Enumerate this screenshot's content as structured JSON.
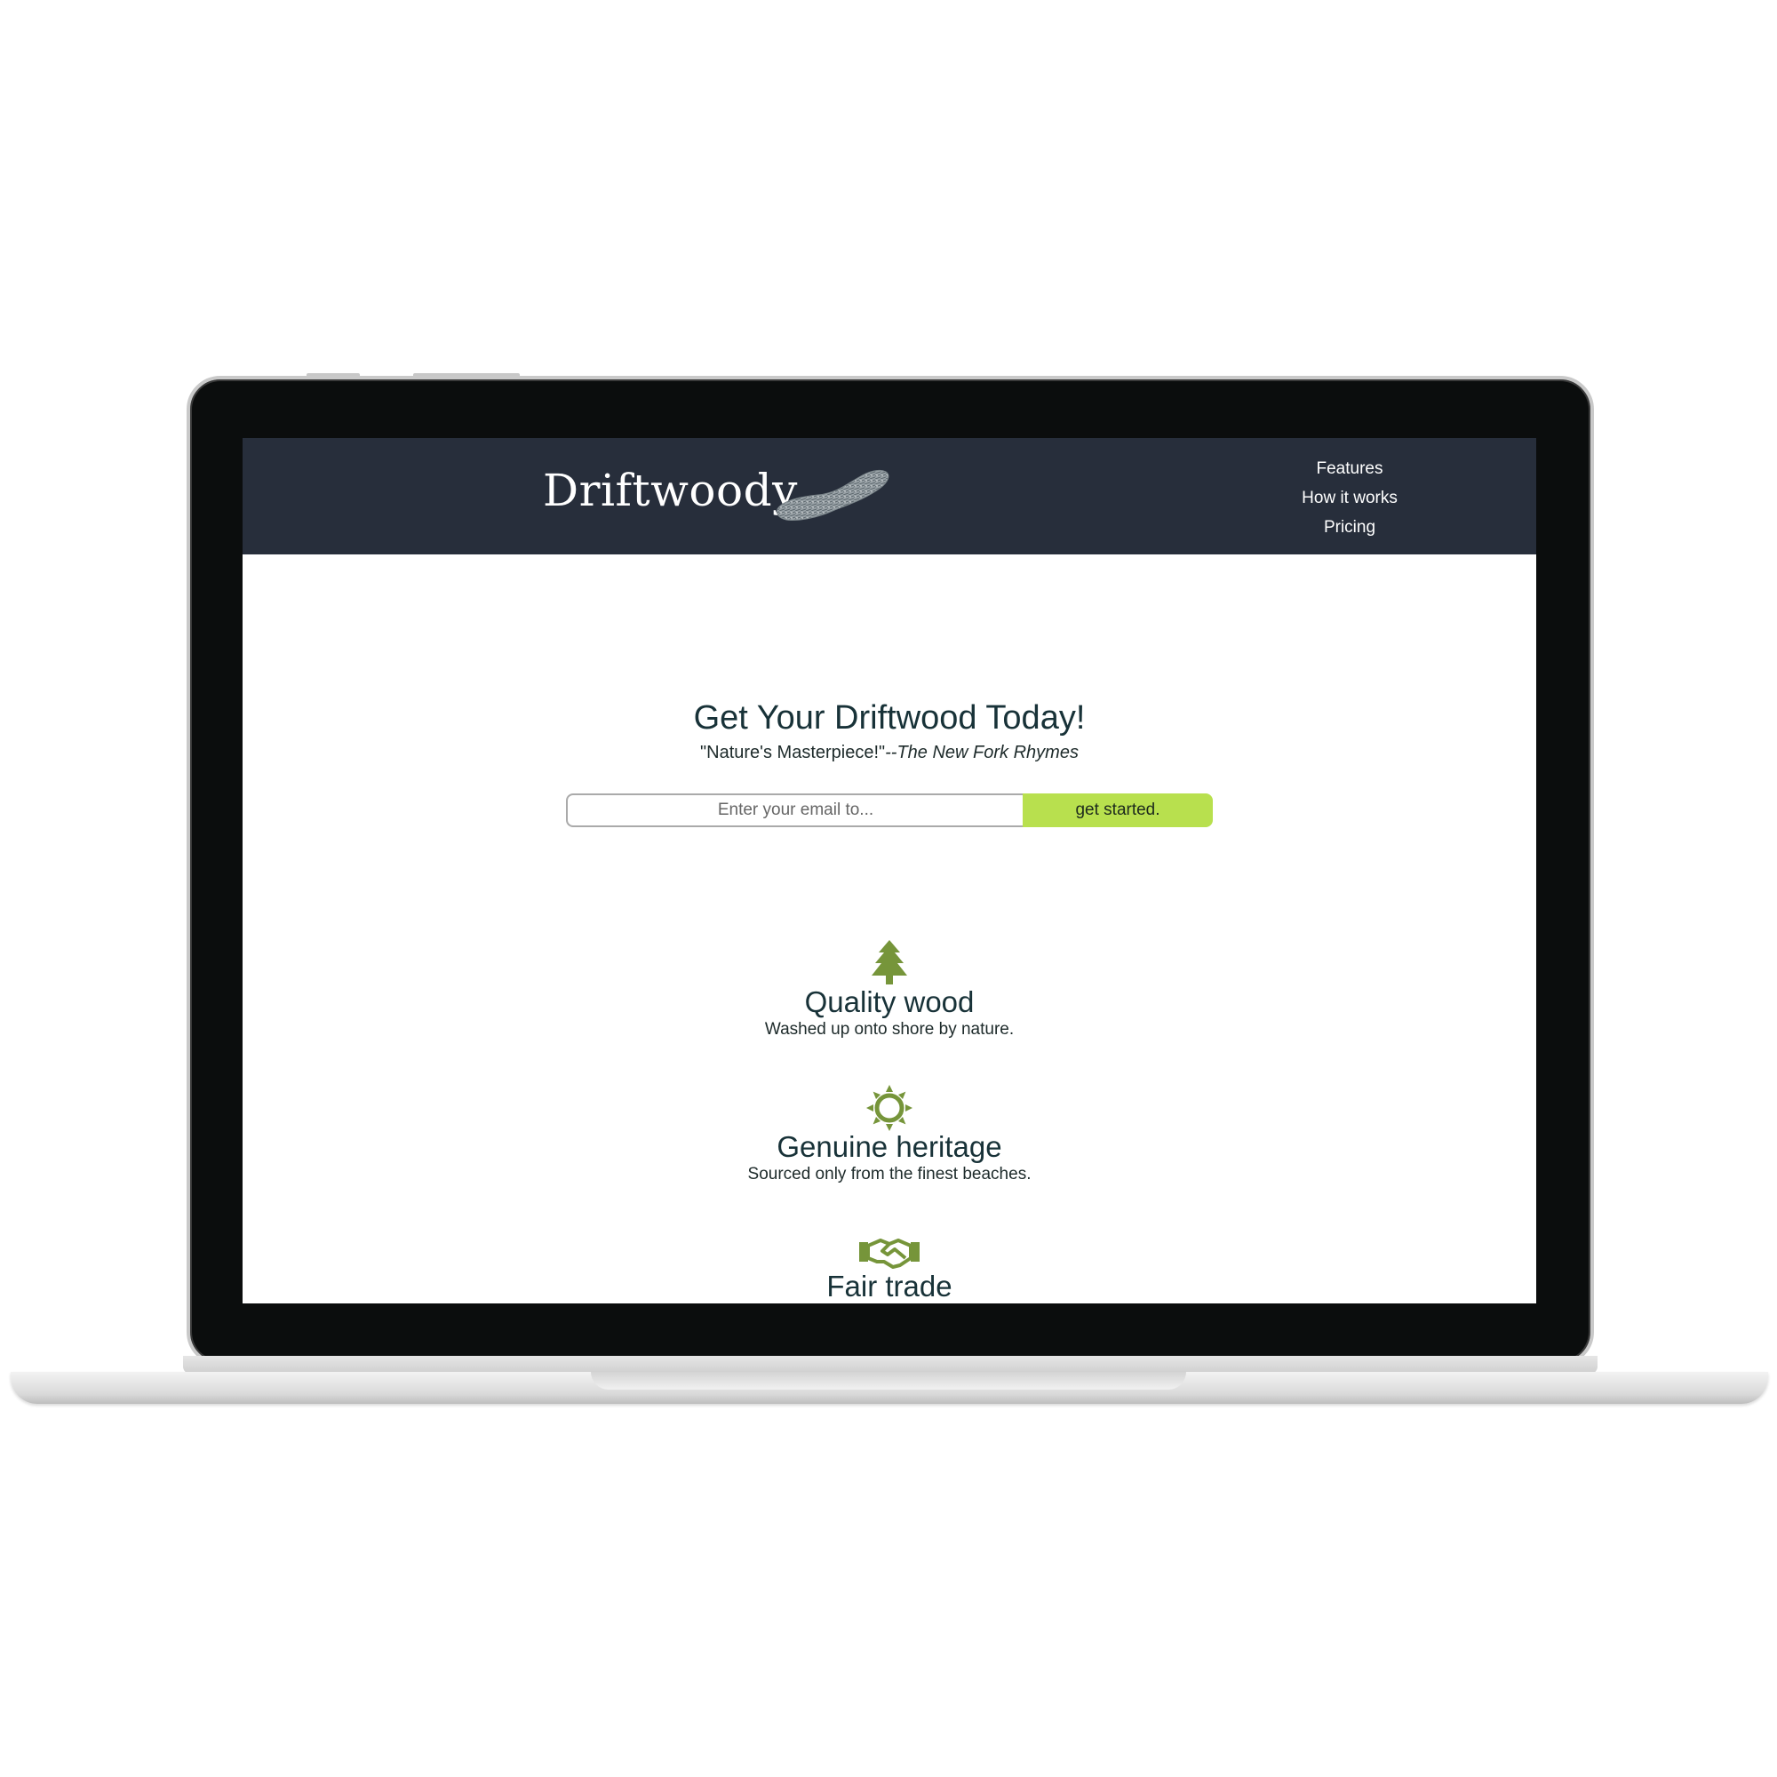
{
  "header": {
    "logo_text": "Driftwoody",
    "nav": [
      {
        "label": "Features"
      },
      {
        "label": "How it works"
      },
      {
        "label": "Pricing"
      }
    ]
  },
  "hero": {
    "title": "Get Your Driftwood Today!",
    "quote": "\"Nature's Masterpiece!\"",
    "quote_source": "--The New Fork Rhymes",
    "email_placeholder": "Enter your email to...",
    "button_label": "get started."
  },
  "features": [
    {
      "icon": "tree-icon",
      "title": "Quality wood",
      "description": "Washed up onto shore by nature."
    },
    {
      "icon": "sun-icon",
      "title": "Genuine heritage",
      "description": "Sourced only from the finest beaches."
    },
    {
      "icon": "handshake-icon",
      "title": "Fair trade",
      "description": ""
    }
  ],
  "colors": {
    "header_bg": "#272e3b",
    "accent": "#b8e04e",
    "icon_green": "#76953a",
    "heading": "#183238"
  }
}
